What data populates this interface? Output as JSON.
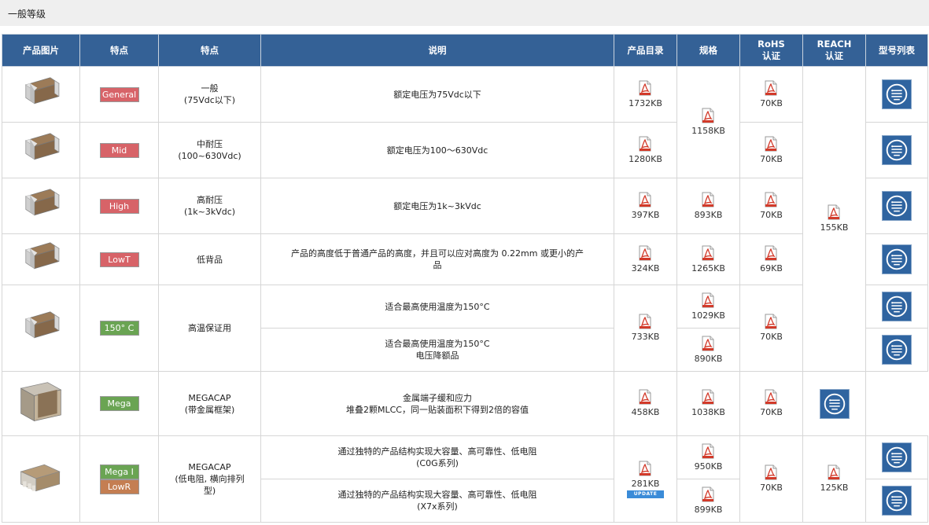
{
  "section": {
    "title": "一般等级"
  },
  "headers": {
    "image": "产品图片",
    "feature_badge": "特点",
    "feature_text": "特点",
    "description": "说明",
    "catalog": "产品目录",
    "spec": "规格",
    "rohs": [
      "RoHS",
      "认证"
    ],
    "reach": [
      "REACH",
      "认证"
    ],
    "list": "型号列表"
  },
  "rows": [
    {
      "badge": "General",
      "feature": [
        "一般",
        "(75Vdc以下)"
      ],
      "description": [
        "额定电压为75Vdc以下"
      ],
      "catalog": "1732KB",
      "rohs": "70KB"
    },
    {
      "badge": "Mid",
      "feature": [
        "中耐压",
        "(100~630Vdc)"
      ],
      "description": [
        "额定电压为100～630Vdc"
      ],
      "catalog": "1280KB",
      "rohs": "70KB"
    },
    {
      "badge": "High",
      "feature": [
        "高耐压",
        "(1k~3kVdc)"
      ],
      "description": [
        "额定电压为1k~3kVdc"
      ],
      "catalog": "397KB",
      "spec": "893KB",
      "rohs": "70KB"
    },
    {
      "badge": "LowT",
      "feature": [
        "低背品"
      ],
      "description": [
        "产品的高度低于普通产品的高度，并且可以应对高度为 0.22mm 或更小的产",
        "品"
      ],
      "catalog": "324KB",
      "spec": "1265KB",
      "rohs": "69KB"
    },
    {
      "badge": "150° C",
      "feature": [
        "高温保证用"
      ],
      "description_a": [
        "适合最高使用温度为150°C"
      ],
      "description_b": [
        "适合最高使用温度为150°C",
        "电压降额品"
      ],
      "catalog": "733KB",
      "spec_a": "1029KB",
      "spec_b": "890KB",
      "rohs": "70KB"
    },
    {
      "badge": "Mega",
      "feature": [
        "MEGACAP",
        "(带金属框架)"
      ],
      "description": [
        "金属端子缓和应力",
        "堆叠2颗MLCC，同一贴装面积下得到2倍的容值"
      ],
      "catalog": "458KB",
      "spec": "1038KB",
      "rohs": "70KB"
    },
    {
      "badge": "Mega I",
      "badge2": "LowR",
      "feature": [
        "MEGACAP",
        "(低电阻, 横向排列",
        "型)"
      ],
      "description_a": [
        "通过独特的产品结构实现大容量、高可靠性、低电阻",
        "(C0G系列)"
      ],
      "description_b": [
        "通过独特的产品结构实现大容量、高可靠性、低电阻",
        "(X7x系列)"
      ],
      "catalog": "281KB",
      "catalog_update": "UPDATE",
      "spec_a": "950KB",
      "spec_b": "899KB",
      "rohs": "70KB",
      "reach": "125KB"
    }
  ],
  "shared": {
    "spec_rows_1_2": "1158KB",
    "reach_rows_1_6": "155KB"
  },
  "colors": {
    "header_bg": "#346196",
    "badge_red": "#d76368",
    "badge_green": "#6aa453",
    "badge_brown": "#c47e52",
    "list_icon_bg": "#2f64a0"
  },
  "icons": {
    "file": "pdf-file-icon",
    "list": "part-number-list-icon"
  }
}
